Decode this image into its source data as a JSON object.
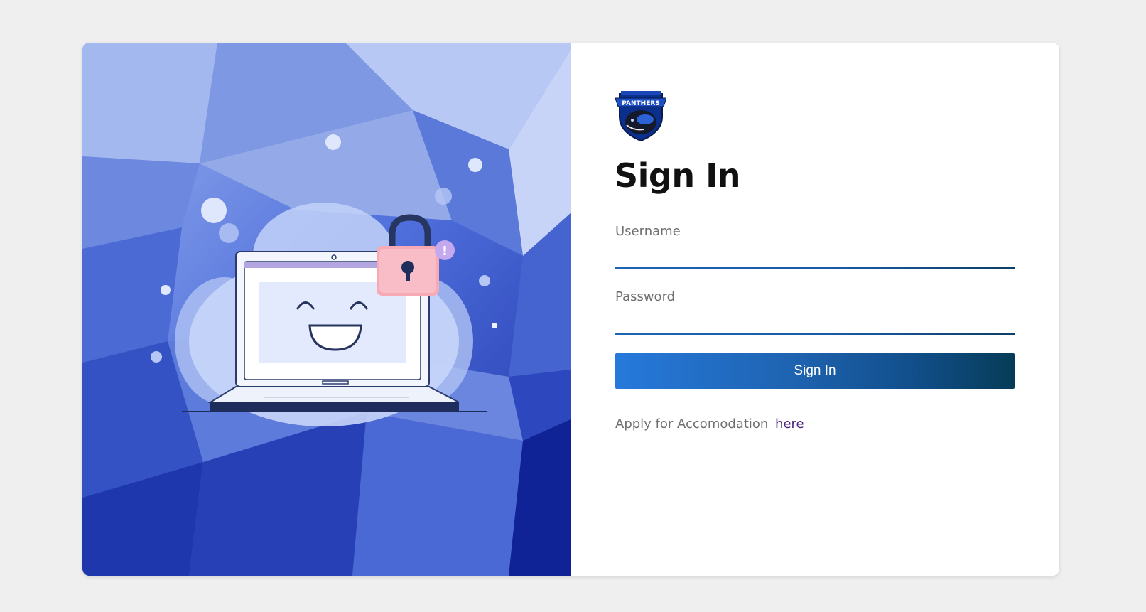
{
  "form": {
    "title": "Sign In",
    "username_label": "Username",
    "username_value": "",
    "password_label": "Password",
    "password_value": "",
    "submit_label": "Sign In",
    "accommodation_text": "Apply for Accomodation",
    "accommodation_link": "here"
  },
  "logo": {
    "icon": "panther-shield-logo",
    "text": "PANTHERS"
  },
  "illustration": {
    "icon": "laptop-lock-illustration",
    "alert_symbol": "!"
  },
  "colors": {
    "page_background": "#efefef",
    "button_gradient_start": "#2679db",
    "button_gradient_end": "#063c58",
    "underline": "#1a5aa5",
    "link": "#4b2380",
    "hero_blue": "#3f5fd0"
  }
}
